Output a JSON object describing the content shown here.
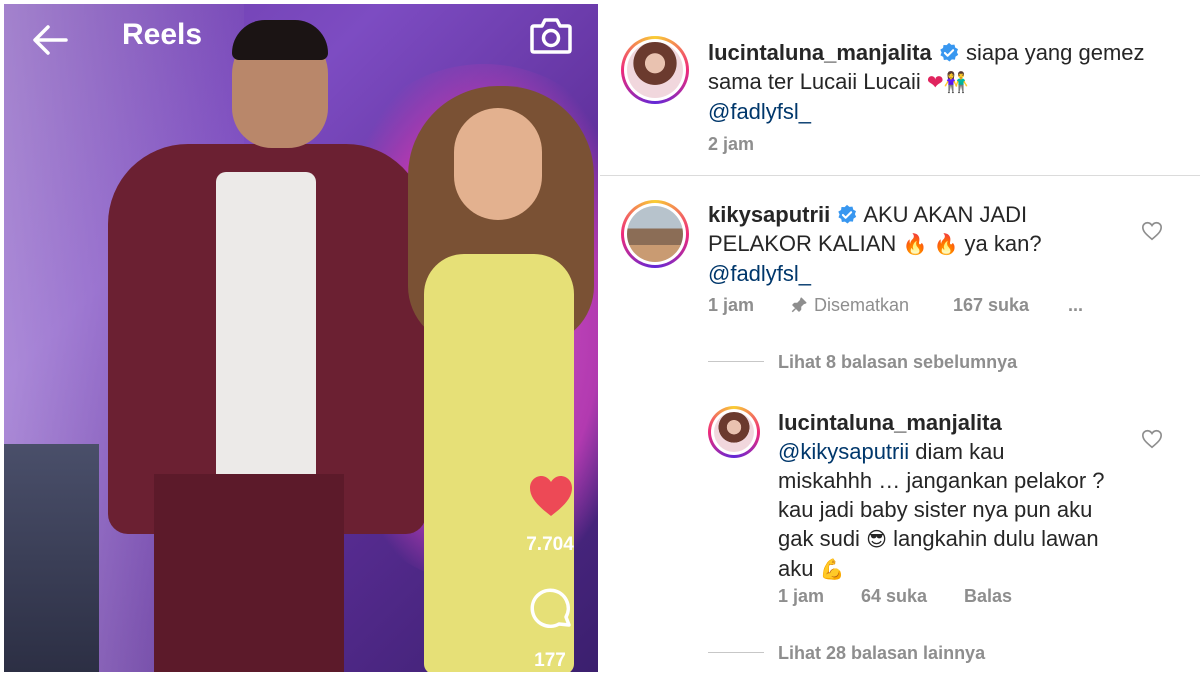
{
  "reel": {
    "title": "Reels",
    "like_count": "7.704",
    "comment_count": "177"
  },
  "caption": {
    "username": "lucintaluna_manjalita",
    "text": "siapa yang gemez sama ter Lucaii Lucaii",
    "mention": "@fadlyfsl_",
    "time": "2 jam"
  },
  "comment": {
    "username": "kikysaputrii",
    "text_line1": "AKU AKAN JADI",
    "text_line2a": "PELAKOR KALIAN",
    "text_line2b": "ya kan?",
    "mention": "@fadlyfsl_",
    "time": "1 jam",
    "pinned_label": "Disematkan",
    "likes": "167 suka",
    "more": "..."
  },
  "view_previous_replies": "Lihat 8 balasan sebelumnya",
  "reply": {
    "username": "lucintaluna_manjalita",
    "mention": "@kikysaputrii",
    "line1": "diam kau",
    "line2": "miskahhh … jangankan pelakor ?",
    "line3": "kau jadi baby sister nya pun aku",
    "line4a": "gak sudi",
    "line4b": "langkahin dulu lawan",
    "line5": "aku",
    "time": "1 jam",
    "likes": "64 suka",
    "reply_label": "Balas"
  },
  "view_more_replies": "Lihat 28 balasan lainnya",
  "colors": {
    "verified": "#3897f0",
    "text": "#262626",
    "mention": "#00376b",
    "meta": "#8e8e8e"
  }
}
